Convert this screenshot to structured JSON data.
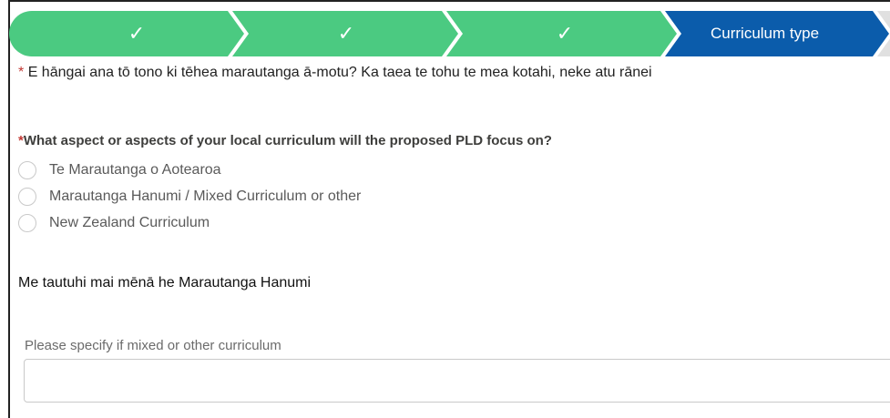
{
  "path": {
    "stages": [
      {
        "status": "complete",
        "icon": "check-icon",
        "symbol": "✓"
      },
      {
        "status": "complete",
        "icon": "check-icon",
        "symbol": "✓"
      },
      {
        "status": "complete",
        "icon": "check-icon",
        "symbol": "✓"
      },
      {
        "status": "current",
        "label": "Curriculum type"
      }
    ],
    "colors": {
      "complete": "#4bca81",
      "current": "#0b5cab",
      "upcoming": "#e0e0e0"
    }
  },
  "question1": {
    "required_marker": "*",
    "text": "E hāngai ana tō tono ki tēhea marautanga ā-motu? Ka taea te tohu te mea kotahi, neke atu rānei"
  },
  "question2": {
    "required_marker": "*",
    "text": "What aspect or aspects of your local curriculum will the proposed PLD focus on?",
    "options": [
      {
        "label": "Te Marautanga o Aotearoa"
      },
      {
        "label": "Marautanga Hanumi / Mixed Curriculum or other"
      },
      {
        "label": "New Zealand Curriculum"
      }
    ]
  },
  "mixed": {
    "title": "Me tautuhi mai mēnā he Marautanga Hanumi",
    "field_label": "Please specify if mixed or other curriculum",
    "value": ""
  }
}
